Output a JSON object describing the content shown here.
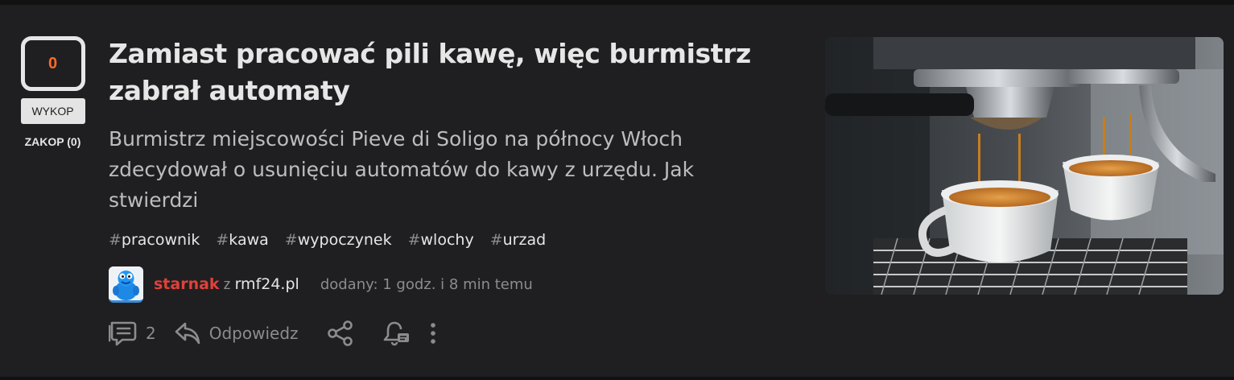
{
  "vote": {
    "count": "0",
    "wykop_label": "WYKOP",
    "zakop_label": "ZAKOP (0)"
  },
  "post": {
    "title": "Zamiast pracować pili kawę, więc burmistrz zabrał automaty",
    "description": "Burmistrz miejscowości Pieve di Soligo na północy Włoch zdecydował o usunięciu automatów do kawy z urzędu. Jak stwierdzi",
    "tags": [
      "pracownik",
      "kawa",
      "wypoczynek",
      "wlochy",
      "urzad"
    ],
    "tag_prefix": "#",
    "author": "starnak",
    "from_label": "z",
    "source": "rmf24.pl",
    "added": "dodany: 1 godz. i 8 min temu"
  },
  "actions": {
    "comments_count": "2",
    "reply_label": "Odpowiedz"
  },
  "icons": {
    "comments": "comments-icon",
    "reply": "reply-icon",
    "share": "share-icon",
    "notify": "bell-icon",
    "more": "more-vertical-icon"
  },
  "colors": {
    "accent": "#ff6a26",
    "author": "#e0413b",
    "card_bg": "#1f1f21"
  }
}
